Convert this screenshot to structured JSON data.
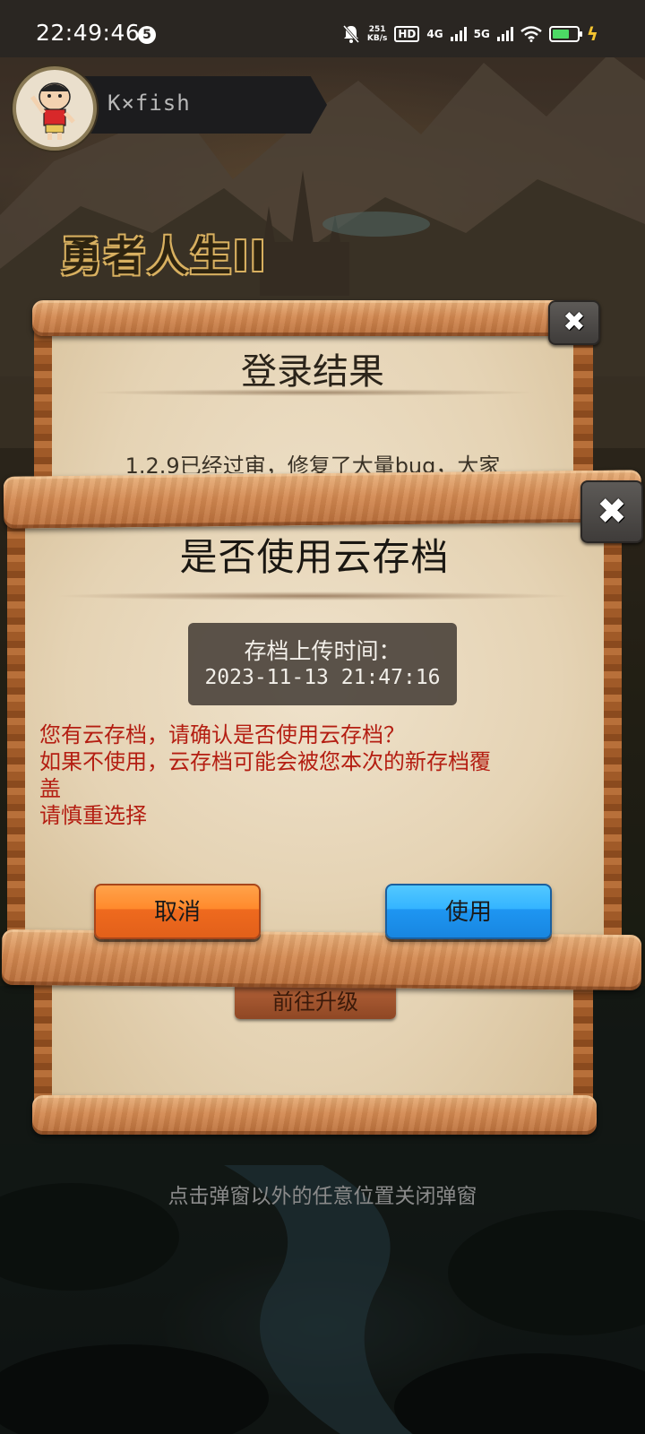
{
  "status_bar": {
    "time": "22:49:46",
    "notification_count": "5",
    "net_speed_value": "251",
    "net_speed_unit": "KB/s",
    "hd_label": "HD",
    "net_4g": "4G",
    "net_5g": "5G",
    "battery_level": 0.7,
    "icons": [
      "mute-bell-icon",
      "hd-icon",
      "signal-4g-icon",
      "signal-5g-icon",
      "wifi-icon",
      "battery-icon",
      "charging-bolt-icon"
    ]
  },
  "player": {
    "name": "K×fish",
    "avatar_icon": "cartoon-character-avatar"
  },
  "game": {
    "title_line1": "勇者人生II"
  },
  "login_dialog": {
    "title": "登录结果",
    "message_partial": "1.2.9已经过审，修复了大量bug，大家",
    "button_label": "前往升级",
    "close_icon": "close-x-icon"
  },
  "cloud_save_dialog": {
    "title": "是否使用云存档",
    "time_label": "存档上传时间：",
    "time_value": "2023-11-13 21:47:16",
    "warning_lines": [
      "您有云存档，请确认是否使用云存档？",
      "如果不使用，云存档可能会被您本次的新存档覆",
      "盖",
      "请慎重选择"
    ],
    "cancel_label": "取消",
    "use_label": "使用",
    "close_icon": "close-x-icon",
    "colors": {
      "warning_text": "#b41e12",
      "cancel_button": "#ff8a2c",
      "use_button": "#34b4ff"
    }
  },
  "hint": "点击弹窗以外的任意位置关闭弹窗"
}
